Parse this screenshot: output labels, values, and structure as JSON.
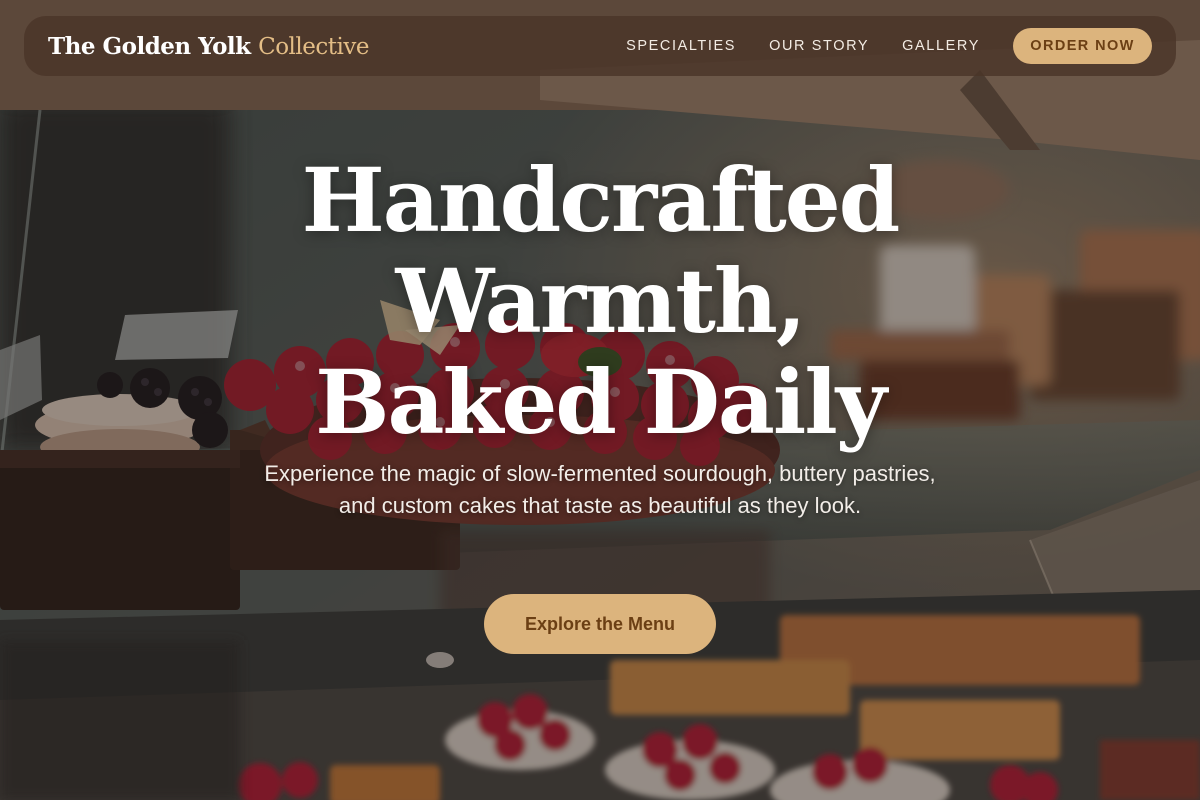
{
  "colors": {
    "accent": "#dcb47d",
    "accent_text": "#6b3f14",
    "nav_bg": "#4a3428",
    "headline": "#ffffff"
  },
  "nav": {
    "brand_main": "The Golden Yolk",
    "brand_accent": "Collective",
    "links": [
      {
        "label": "SPECIALTIES"
      },
      {
        "label": "OUR STORY"
      },
      {
        "label": "GALLERY"
      }
    ],
    "order_button": "ORDER NOW"
  },
  "hero": {
    "background": "bakery display case with raspberry tart, pastries and cakes",
    "title_lines": [
      "Handcrafted",
      "Warmth,",
      "Baked Daily"
    ],
    "subtitle": "Experience the magic of slow-fermented sourdough, buttery pastries, and custom cakes that taste as beautiful as they look.",
    "cta_label": "Explore the Menu"
  }
}
